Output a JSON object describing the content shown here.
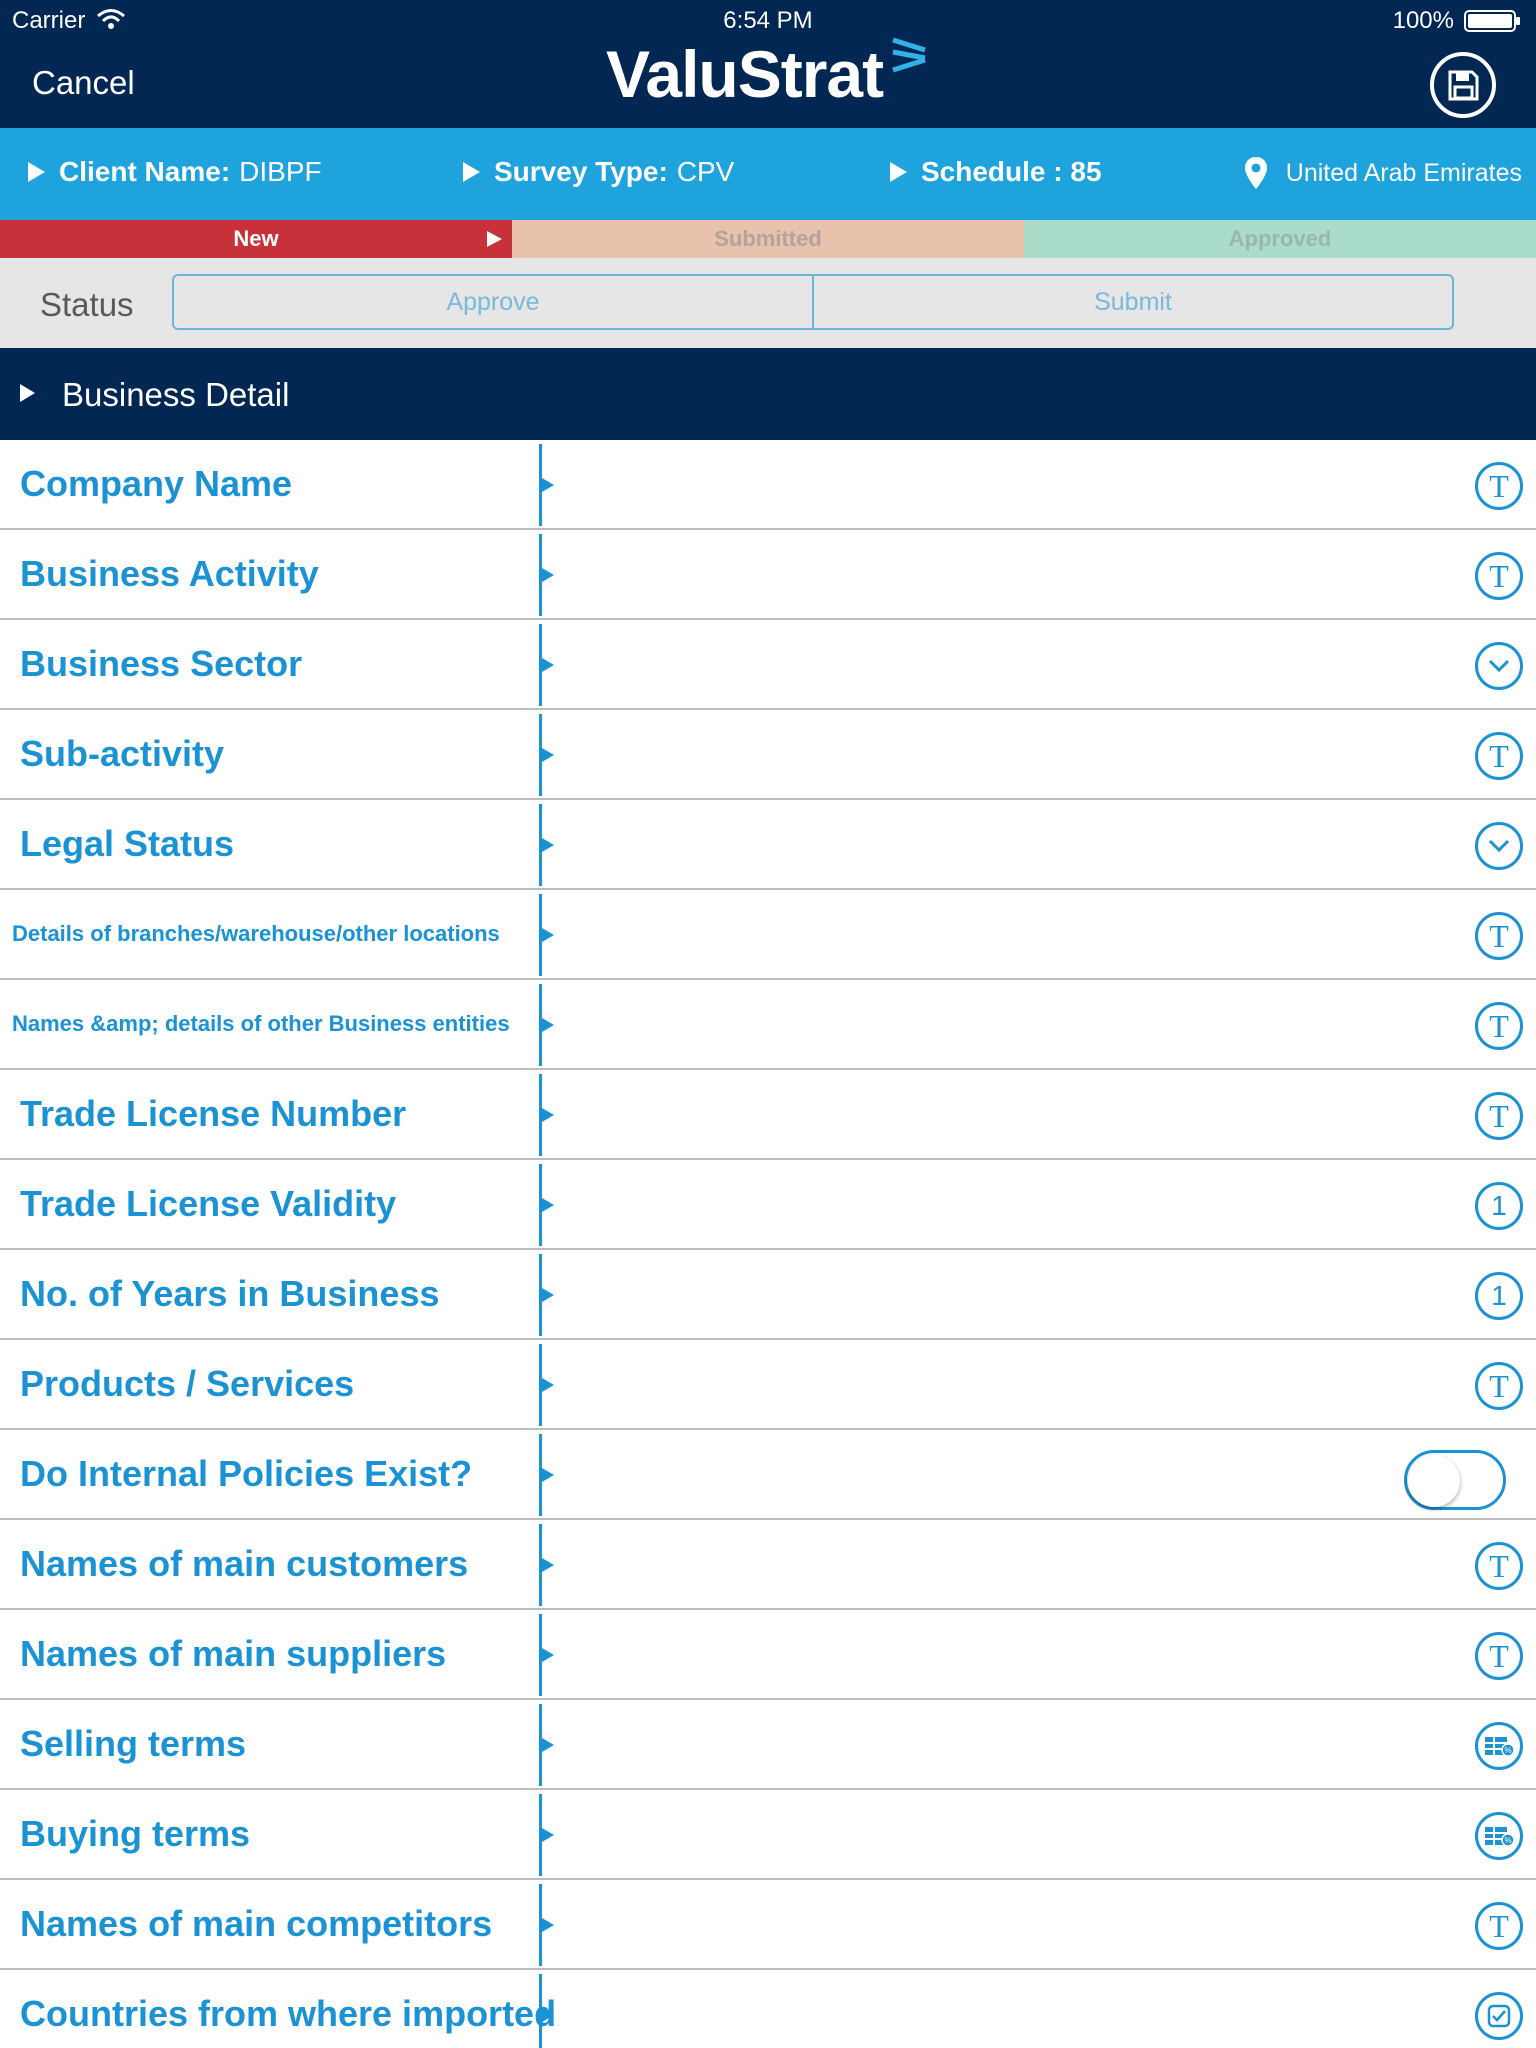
{
  "status_bar": {
    "carrier": "Carrier",
    "time": "6:54 PM",
    "battery": "100%"
  },
  "nav": {
    "cancel_label": "Cancel",
    "logo_text": "ValuStrat",
    "save_icon": "floppy-disk-icon"
  },
  "info": {
    "client_label": "Client Name:",
    "client_value": "DIBPF",
    "survey_label": "Survey Type:",
    "survey_value": "CPV",
    "schedule_label": "Schedule : 85",
    "location": "United Arab Emirates"
  },
  "progress": {
    "stages": [
      "New",
      "Submitted",
      "Approved"
    ],
    "current": "New"
  },
  "status": {
    "label": "Status",
    "approve_label": "Approve",
    "submit_label": "Submit"
  },
  "section": {
    "title": "Business Detail"
  },
  "fields": [
    {
      "label": "Company Name",
      "icon": "text-icon",
      "glyph": "T"
    },
    {
      "label": "Business Activity",
      "icon": "text-icon",
      "glyph": "T"
    },
    {
      "label": "Business Sector",
      "icon": "dropdown-icon",
      "glyph": ""
    },
    {
      "label": "Sub-activity",
      "icon": "text-icon",
      "glyph": "T"
    },
    {
      "label": "Legal Status",
      "icon": "dropdown-icon",
      "glyph": ""
    },
    {
      "label": "Details of branches/warehouse/other locations",
      "icon": "text-icon",
      "glyph": "T"
    },
    {
      "label": "Names &amp; details of other Business entities",
      "icon": "text-icon",
      "glyph": "T"
    },
    {
      "label": "Trade License Number",
      "icon": "text-icon",
      "glyph": "T"
    },
    {
      "label": "Trade License Validity",
      "icon": "number-icon",
      "glyph": "1"
    },
    {
      "label": "No. of Years in Business",
      "icon": "number-icon",
      "glyph": "1"
    },
    {
      "label": "Products / Services",
      "icon": "text-icon",
      "glyph": "T"
    },
    {
      "label": "Do Internal Policies Exist?",
      "icon": "toggle-switch",
      "glyph": ""
    },
    {
      "label": "Names of main customers",
      "icon": "text-icon",
      "glyph": "T"
    },
    {
      "label": "Names of main suppliers",
      "icon": "text-icon",
      "glyph": "T"
    },
    {
      "label": "Selling terms",
      "icon": "table-percent-icon",
      "glyph": ""
    },
    {
      "label": "Buying terms",
      "icon": "table-percent-icon",
      "glyph": ""
    },
    {
      "label": "Names of main competitors",
      "icon": "text-icon",
      "glyph": "T"
    },
    {
      "label": "Countries from where imported",
      "icon": "checkbox-icon",
      "glyph": ""
    }
  ],
  "colors": {
    "navy": "#012752",
    "accent_blue": "#1fa3dd",
    "label_blue": "#1a92d3",
    "new_red": "#c7323a",
    "submitted_peach": "#e8c2ad",
    "approved_green": "#a9dcc9"
  }
}
